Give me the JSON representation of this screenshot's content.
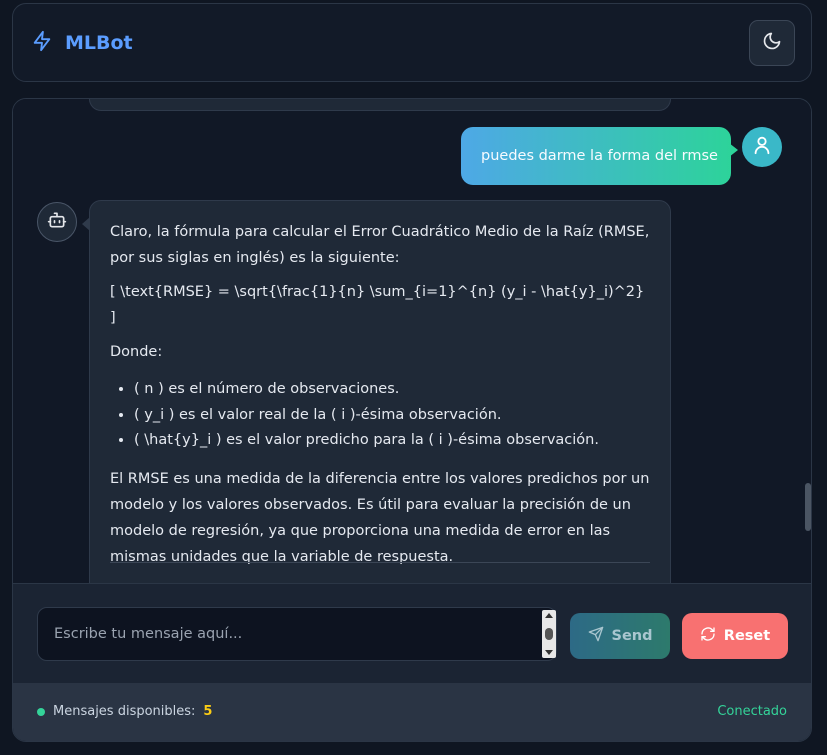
{
  "header": {
    "brand_name": "MLBot",
    "brand_icon": "lightning-icon",
    "theme_icon": "moon-icon"
  },
  "conversation": {
    "user_message": "puedes darme la forma del rmse",
    "bot_message": {
      "intro": "Claro, la fórmula para calcular el Error Cuadrático Medio de la Raíz (RMSE, por sus siglas en inglés) es la siguiente:",
      "formula": "[ \\text{RMSE} = \\sqrt{\\frac{1}{n} \\sum_{i=1}^{n} (y_i - \\hat{y}_i)^2} ]",
      "donde": "Donde:",
      "bullets": [
        "( n ) es el número de observaciones.",
        "( y_i ) es el valor real de la ( i )-ésima observación.",
        "( \\hat{y}_i ) es el valor predicho para la ( i )-ésima observación."
      ],
      "explanation": "El RMSE es una medida de la diferencia entre los valores predichos por un modelo y los valores observados. Es útil para evaluar la precisión de un modelo de regresión, ya que proporciona una medida de error en las mismas unidades que la variable de respuesta."
    }
  },
  "composer": {
    "placeholder": "Escribe tu mensaje aquí...",
    "send_label": "Send",
    "reset_label": "Reset"
  },
  "footer": {
    "messages_label": "Mensajes disponibles:",
    "messages_count": "5",
    "status": "Conectado"
  },
  "colors": {
    "accent": "#5b9dff",
    "user_gradient_start": "#4ea8e6",
    "user_gradient_end": "#2dd39a",
    "reset": "#f87171",
    "status_green": "#34d399",
    "count_yellow": "#facc15"
  }
}
